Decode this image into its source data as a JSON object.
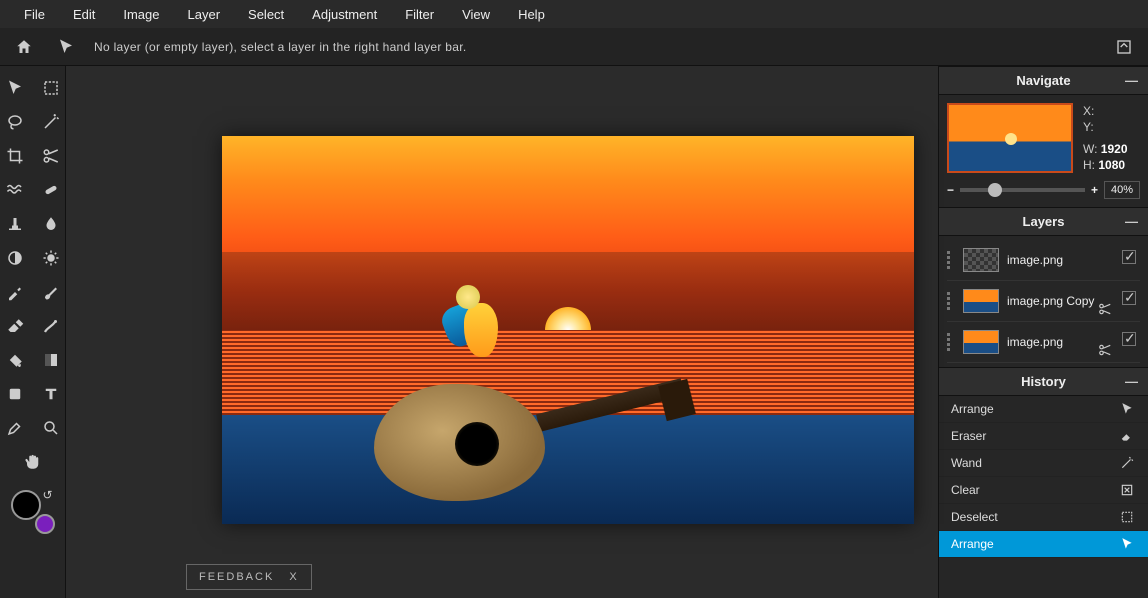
{
  "menubar": [
    "File",
    "Edit",
    "Image",
    "Layer",
    "Select",
    "Adjustment",
    "Filter",
    "View",
    "Help"
  ],
  "options": {
    "hint": "No layer (or empty layer), select a layer in the right hand layer bar."
  },
  "zoom": {
    "percent": "40%"
  },
  "navigate": {
    "title": "Navigate",
    "x_label": "X:",
    "y_label": "Y:",
    "x": "",
    "y": "",
    "w_label": "W:",
    "h_label": "H:",
    "w": "1920",
    "h": "1080"
  },
  "layers_panel": {
    "title": "Layers",
    "items": [
      {
        "name": "image.png",
        "thumb": "checker"
      },
      {
        "name": "image.png Copy",
        "thumb": "sunset"
      },
      {
        "name": "image.png",
        "thumb": "sunset"
      }
    ]
  },
  "history_panel": {
    "title": "History",
    "items": [
      {
        "label": "Arrange",
        "icon": "arrow",
        "active": false
      },
      {
        "label": "Eraser",
        "icon": "eraser",
        "active": false
      },
      {
        "label": "Wand",
        "icon": "wand",
        "active": false
      },
      {
        "label": "Clear",
        "icon": "clear",
        "active": false
      },
      {
        "label": "Deselect",
        "icon": "deselect",
        "active": false
      },
      {
        "label": "Arrange",
        "icon": "arrow",
        "active": true
      }
    ]
  },
  "feedback": {
    "label": "FEEDBACK",
    "close": "X"
  },
  "colors": {
    "foreground": "#000000",
    "background": "#7a1fbd"
  },
  "tools": [
    "arrow",
    "marquee",
    "lasso",
    "wand",
    "crop",
    "scissors",
    "waves",
    "band-aid",
    "stamp",
    "drop",
    "circle",
    "sun",
    "eyedropper",
    "brush",
    "eraser",
    "spray",
    "bucket",
    "gradient",
    "shape",
    "text",
    "colorpicker",
    "zoom",
    "hand"
  ]
}
